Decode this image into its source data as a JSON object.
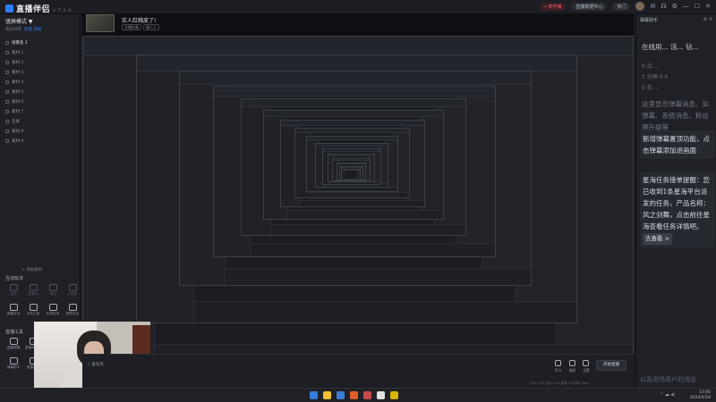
{
  "app": {
    "logo_text": "直播伴侣",
    "version": "v 7.1.4"
  },
  "titlebar": {
    "live_status": "• 未开播",
    "data_center": "直播数据中心",
    "hot": "热门",
    "icons": [
      "message-icon",
      "headset-icon",
      "settings-icon",
      "minimize-icon",
      "maximize-icon",
      "close-icon"
    ]
  },
  "left_panel": {
    "mode_label": "竖屏模式 ▼",
    "scene_header": "我的场景",
    "scene_actions": "新建  添加",
    "scenes": [
      {
        "label": "场景名 1",
        "active": true
      },
      {
        "label": "素材 1",
        "active": false
      },
      {
        "label": "素材 2",
        "active": false
      },
      {
        "label": "素材 3",
        "active": false
      },
      {
        "label": "素材 4",
        "active": false
      },
      {
        "label": "素材 5",
        "active": false
      },
      {
        "label": "素材 6",
        "active": false
      },
      {
        "label": "素材 7",
        "active": false
      },
      {
        "label": "全屏",
        "active": false
      },
      {
        "label": "素材 8",
        "active": false
      },
      {
        "label": "素材 9",
        "active": false
      }
    ],
    "add_source": "+ 添加素材",
    "interaction_title": "互动玩法",
    "interaction_items": [
      {
        "label": "连线",
        "muted": true
      },
      {
        "label": "直播PK",
        "muted": true
      },
      {
        "label": "福袋",
        "muted": true
      },
      {
        "label": "心愿单",
        "muted": true
      },
      {
        "label": "弹幕互动",
        "muted": false
      },
      {
        "label": "互动工具",
        "muted": false
      },
      {
        "label": "礼物互动",
        "muted": false
      },
      {
        "label": "更多玩法",
        "muted": false
      }
    ],
    "tools_title": "直播工具",
    "tool_items": [
      {
        "label": "直播提醒"
      },
      {
        "label": "直播间管理"
      },
      {
        "label": "主播任务"
      },
      {
        "label": "直播数据"
      },
      {
        "label": "弹幕助手"
      },
      {
        "label": "直播回放"
      },
      {
        "label": "直播贴纸"
      },
      {
        "label": "开播设置"
      }
    ],
    "more_tools": "更多工具"
  },
  "preview": {
    "stream_title": "实人红桃皮了!",
    "stream_tags": [
      "主播形象",
      "猫人人"
    ],
    "mic_label": "麦克风"
  },
  "bottom_controls": {
    "items": [
      {
        "label": "声卡",
        "icon": "soundcard-icon"
      },
      {
        "label": "美颜",
        "icon": "beauty-icon"
      },
      {
        "label": "设置",
        "icon": "settings-icon"
      }
    ],
    "live_button": "开始直播",
    "status_text": "CPU 12%  内存 4.2G  帧率 30  码率 0kb/s"
  },
  "right_panel": {
    "header": "弹幕助手",
    "lines": [
      "在线用... 活... 钻...",
      "0 点...",
      "1 分钟 0.0",
      "0 条..."
    ],
    "info_text": "这里显示弹幕消息、如弹幕、系统消息、粉丝牌升级等",
    "card1": "新增弹幕置顶功能，点击弹幕添加进画面",
    "card2": "星海任务接单提醒：您已收到1条星海平台派发的任务，产品名称：风之剑舞，点击前往星海查看任务详情吧。",
    "go_label": "去查看 >",
    "footer": "以及进场用户的消息"
  },
  "taskbar": {
    "time": "13:00",
    "date": "2024/4/18",
    "app_colors": [
      "#2f7de1",
      "#f1c232",
      "#3a7bd5",
      "#e35d2b",
      "#c94a4a",
      "#e0e0e0",
      "#d9b400"
    ]
  }
}
